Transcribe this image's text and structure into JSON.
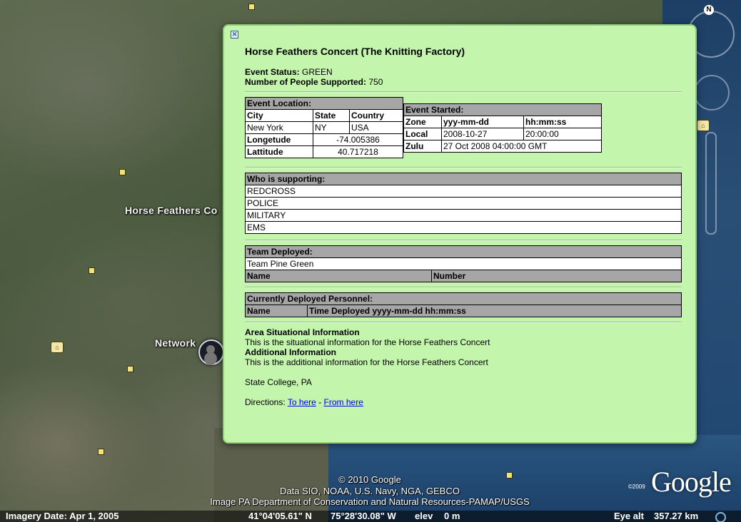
{
  "map": {
    "labels": {
      "place": "Horse Feathers Co",
      "network": "Network"
    },
    "compass_letter": "N",
    "attribution": {
      "copyright": "© 2010 Google",
      "data": "Data SIO, NOAA, U.S. Navy, NGA, GEBCO",
      "image": "Image PA Department of Conservation and Natural Resources-PAMAP/USGS",
      "google_logo": "Google",
      "google_copy": "©2009"
    },
    "status": {
      "imagery_date": "Imagery Date: Apr  1, 2005",
      "lat": "41°04'05.61\" N",
      "lon": "75°28'30.08\" W",
      "elev_label": "elev",
      "elev_value": "0 m",
      "eye_alt_label": "Eye alt",
      "eye_alt_value": "357.27 km"
    }
  },
  "balloon": {
    "close_symbol": "✕",
    "title": "Horse Feathers Concert (The Knitting Factory)",
    "status_label": "Event Status:",
    "status_value": "GREEN",
    "people_label": "Number of People Supported:",
    "people_value": "750",
    "location": {
      "header": "Event Location:",
      "cols": [
        "City",
        "State",
        "Country"
      ],
      "row": [
        "New York",
        "NY",
        "USA"
      ],
      "longitude_label": "Longetude",
      "longitude_value": "-74.005386",
      "latitude_label": "Lattitude",
      "latitude_value": "40.717218"
    },
    "started": {
      "header": "Event Started:",
      "cols": [
        "Zone",
        "yyy-mm-dd",
        "hh:mm:ss"
      ],
      "local_label": "Local",
      "local_date": "2008-10-27",
      "local_time": "20:00:00",
      "zulu_label": "Zulu",
      "zulu_value": "27 Oct 2008 04:00:00 GMT"
    },
    "supporting": {
      "header": "Who is supporting:",
      "items": [
        "REDCROSS",
        "POLICE",
        "MILITARY",
        "EMS"
      ]
    },
    "team": {
      "header": "Team Deployed:",
      "name": "Team Pine Green",
      "col_name": "Name",
      "col_number": "Number"
    },
    "personnel": {
      "header": "Currently Deployed Personnel:",
      "col_name": "Name",
      "col_time": "Time Deployed yyyy-mm-dd hh:mm:ss"
    },
    "area_header": "Area Situational Information",
    "area_text": "This is the situational information for the Horse Feathers Concert",
    "additional_header": "Additional Information",
    "additional_text": "This is the additional information for the Horse Feathers Concert",
    "place": "State College, PA",
    "directions_label": "Directions:",
    "to_here": "To here",
    "separator": "-",
    "from_here": "From here"
  }
}
